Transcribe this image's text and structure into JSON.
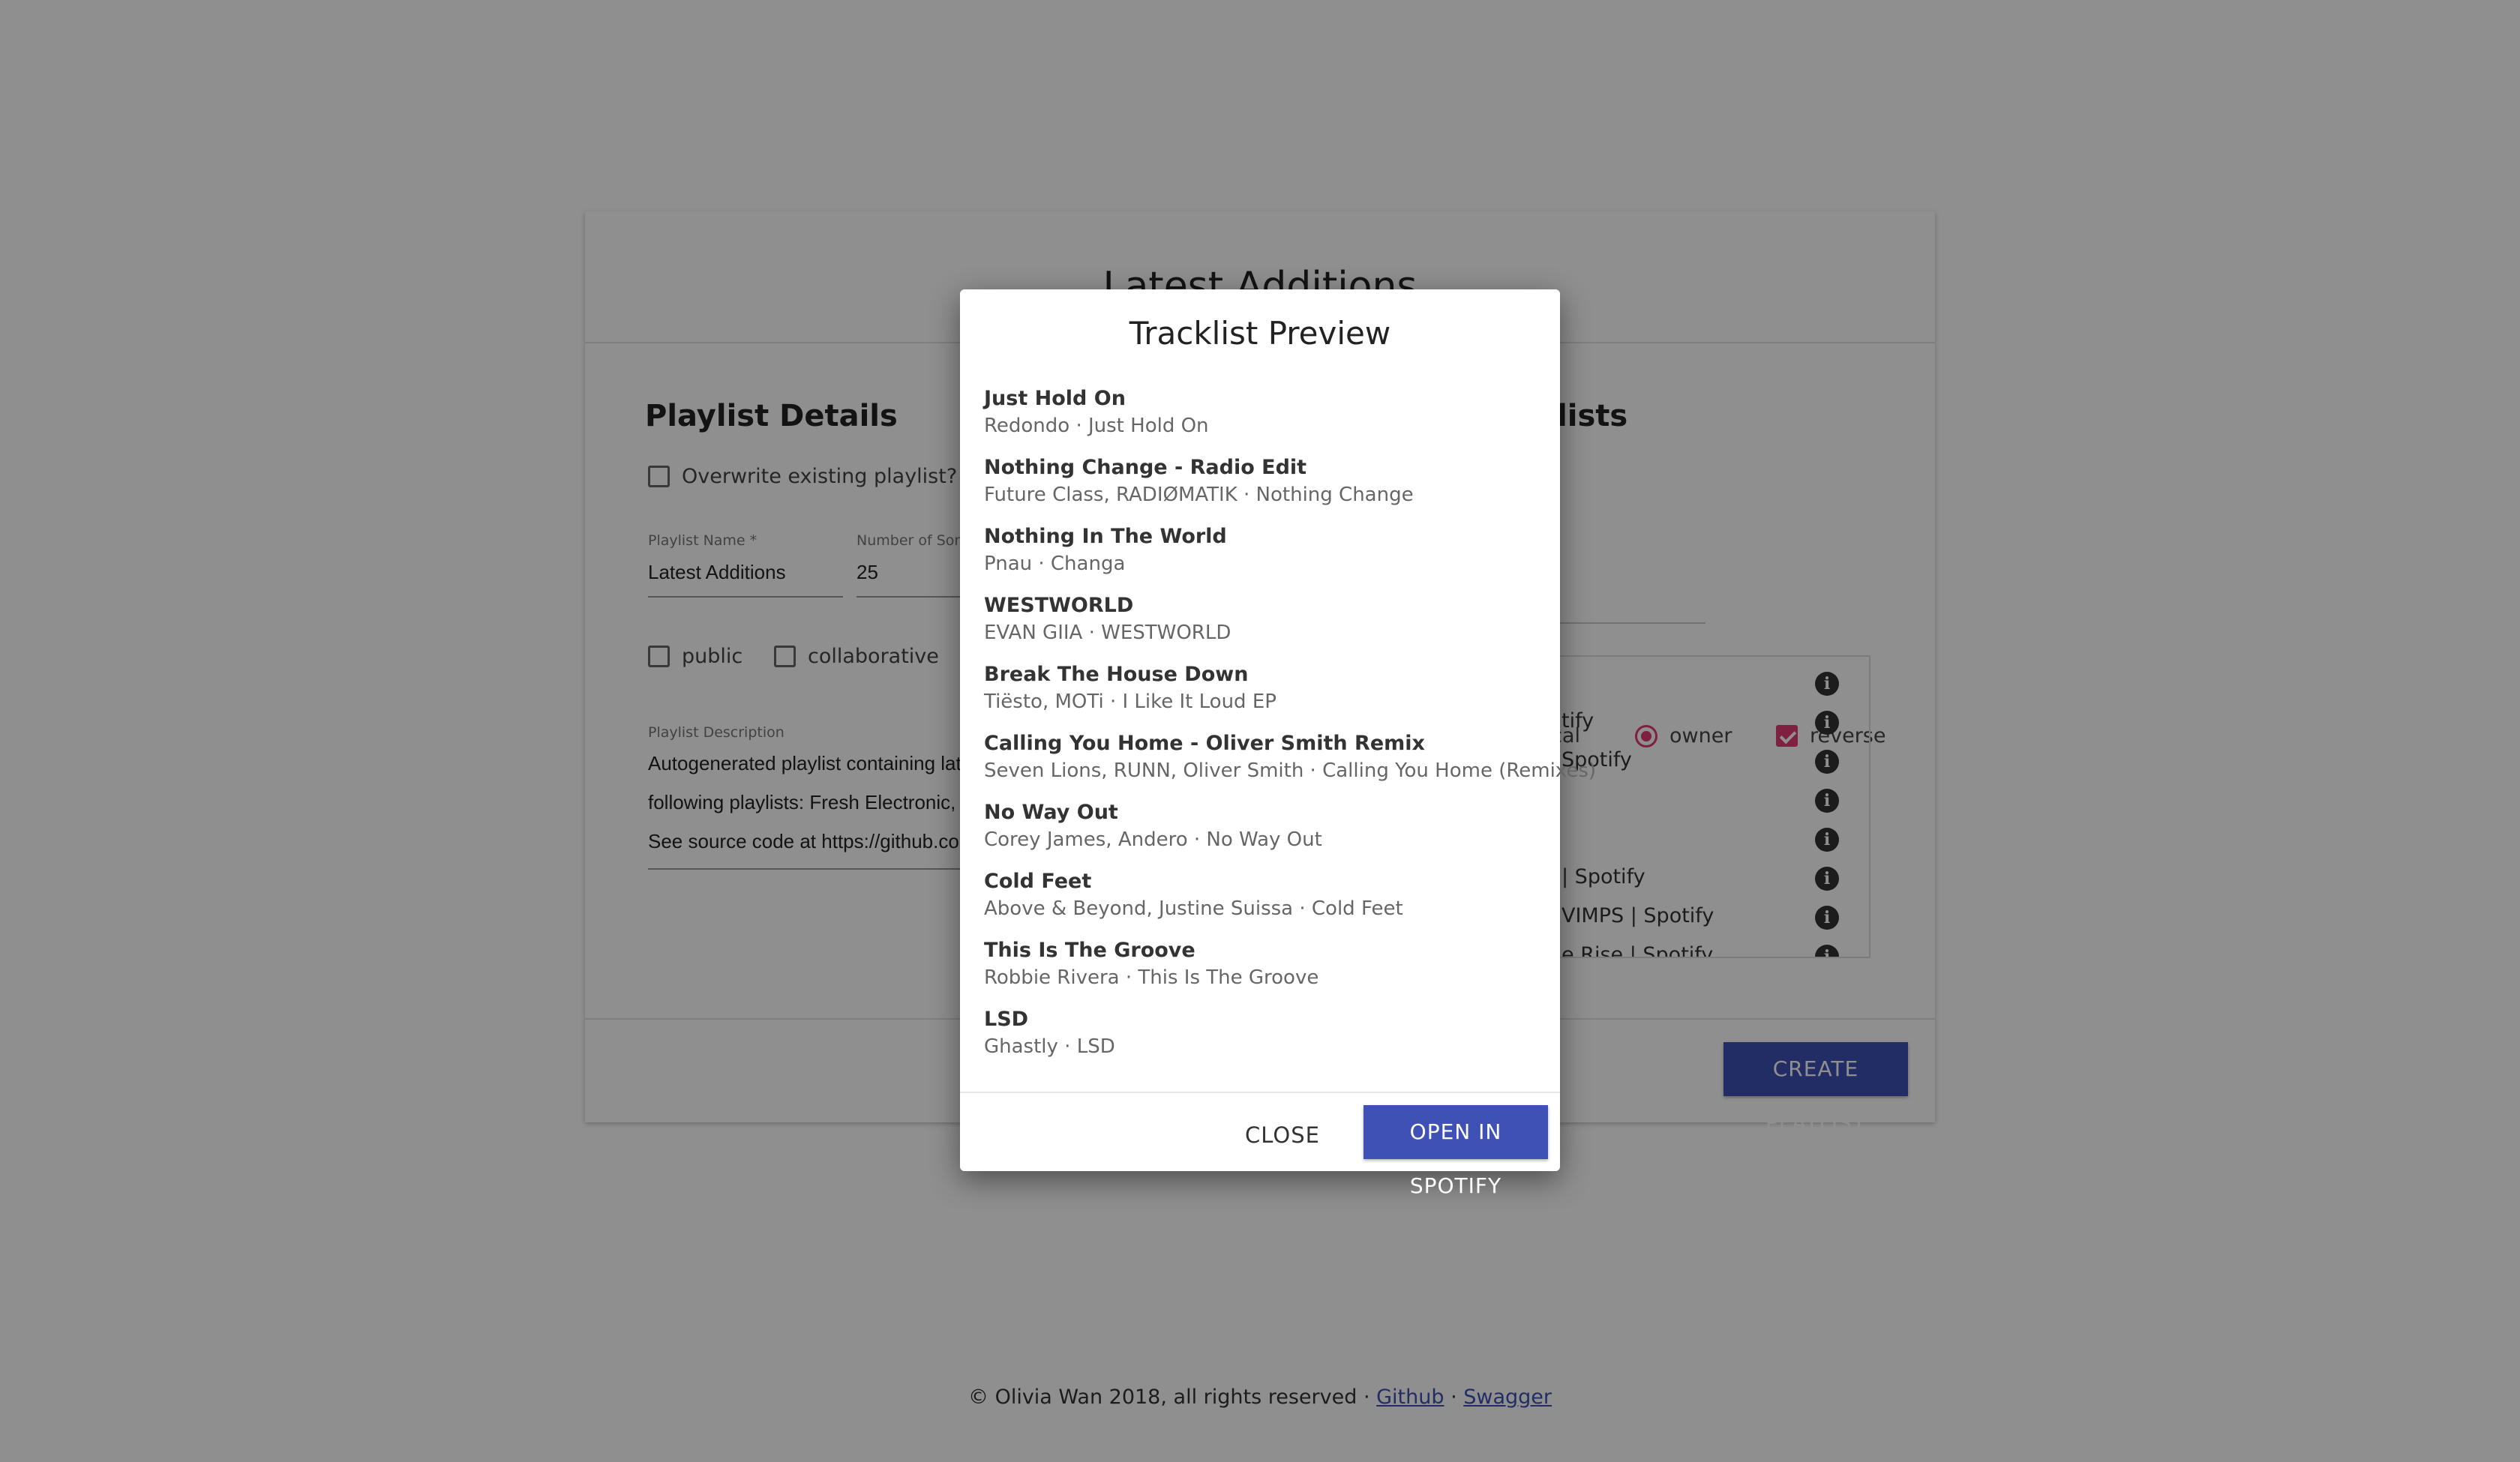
{
  "page": {
    "title": "Latest Additions",
    "details": {
      "heading": "Playlist Details",
      "overwrite_label": "Overwrite existing playlist?",
      "name_label": "Playlist Name *",
      "name_value": "Latest Additions",
      "songs_label": "Number of Songs",
      "songs_value": "25",
      "public_label": "public",
      "collaborative_label": "collaborative",
      "description_label": "Playlist Description",
      "description_lines": [
        "Autogenerated playlist containing latest additions from the",
        "following playlists: Fresh Electronic, Dance Rising, ...",
        "See source code at https://github.com/..."
      ]
    },
    "sources": {
      "heading_partial": "ylists",
      "sort_alpha_partial": "tical",
      "sort_owner_label": "owner",
      "reverse_label": "reverse",
      "items": [
        "",
        "tify",
        "Spotify",
        "",
        "",
        "| Spotify",
        "VIMPS | Spotify",
        "e Rise | Spotify"
      ]
    },
    "create_button": "CREATE PLAYLIST",
    "footer": {
      "copyright": "© Olivia Wan 2018, all rights reserved · ",
      "github": "Github",
      "separator": " · ",
      "swagger": "Swagger"
    }
  },
  "dialog": {
    "title": "Tracklist Preview",
    "tracks": [
      {
        "name": "Just Hold On",
        "meta": "Redondo · Just Hold On"
      },
      {
        "name": "Nothing Change - Radio Edit",
        "meta": "Future Class, RADIØMATIK · Nothing Change"
      },
      {
        "name": "Nothing In The World",
        "meta": "Pnau · Changa"
      },
      {
        "name": "WESTWORLD",
        "meta": "EVAN GIIA · WESTWORLD"
      },
      {
        "name": "Break The House Down",
        "meta": "Tiësto, MOTi · I Like It Loud EP"
      },
      {
        "name": "Calling You Home - Oliver Smith Remix",
        "meta": "Seven Lions, RUNN, Oliver Smith · Calling You Home (Remixes)"
      },
      {
        "name": "No Way Out",
        "meta": "Corey James, Andero · No Way Out"
      },
      {
        "name": "Cold Feet",
        "meta": "Above & Beyond, Justine Suissa · Cold Feet"
      },
      {
        "name": "This Is The Groove",
        "meta": "Robbie Rivera · This Is The Groove"
      },
      {
        "name": "LSD",
        "meta": "Ghastly · LSD"
      }
    ],
    "close_label": "CLOSE",
    "open_label": "OPEN IN SPOTIFY"
  },
  "colors": {
    "primary": "#3f51b5",
    "accent": "#e23a73"
  }
}
